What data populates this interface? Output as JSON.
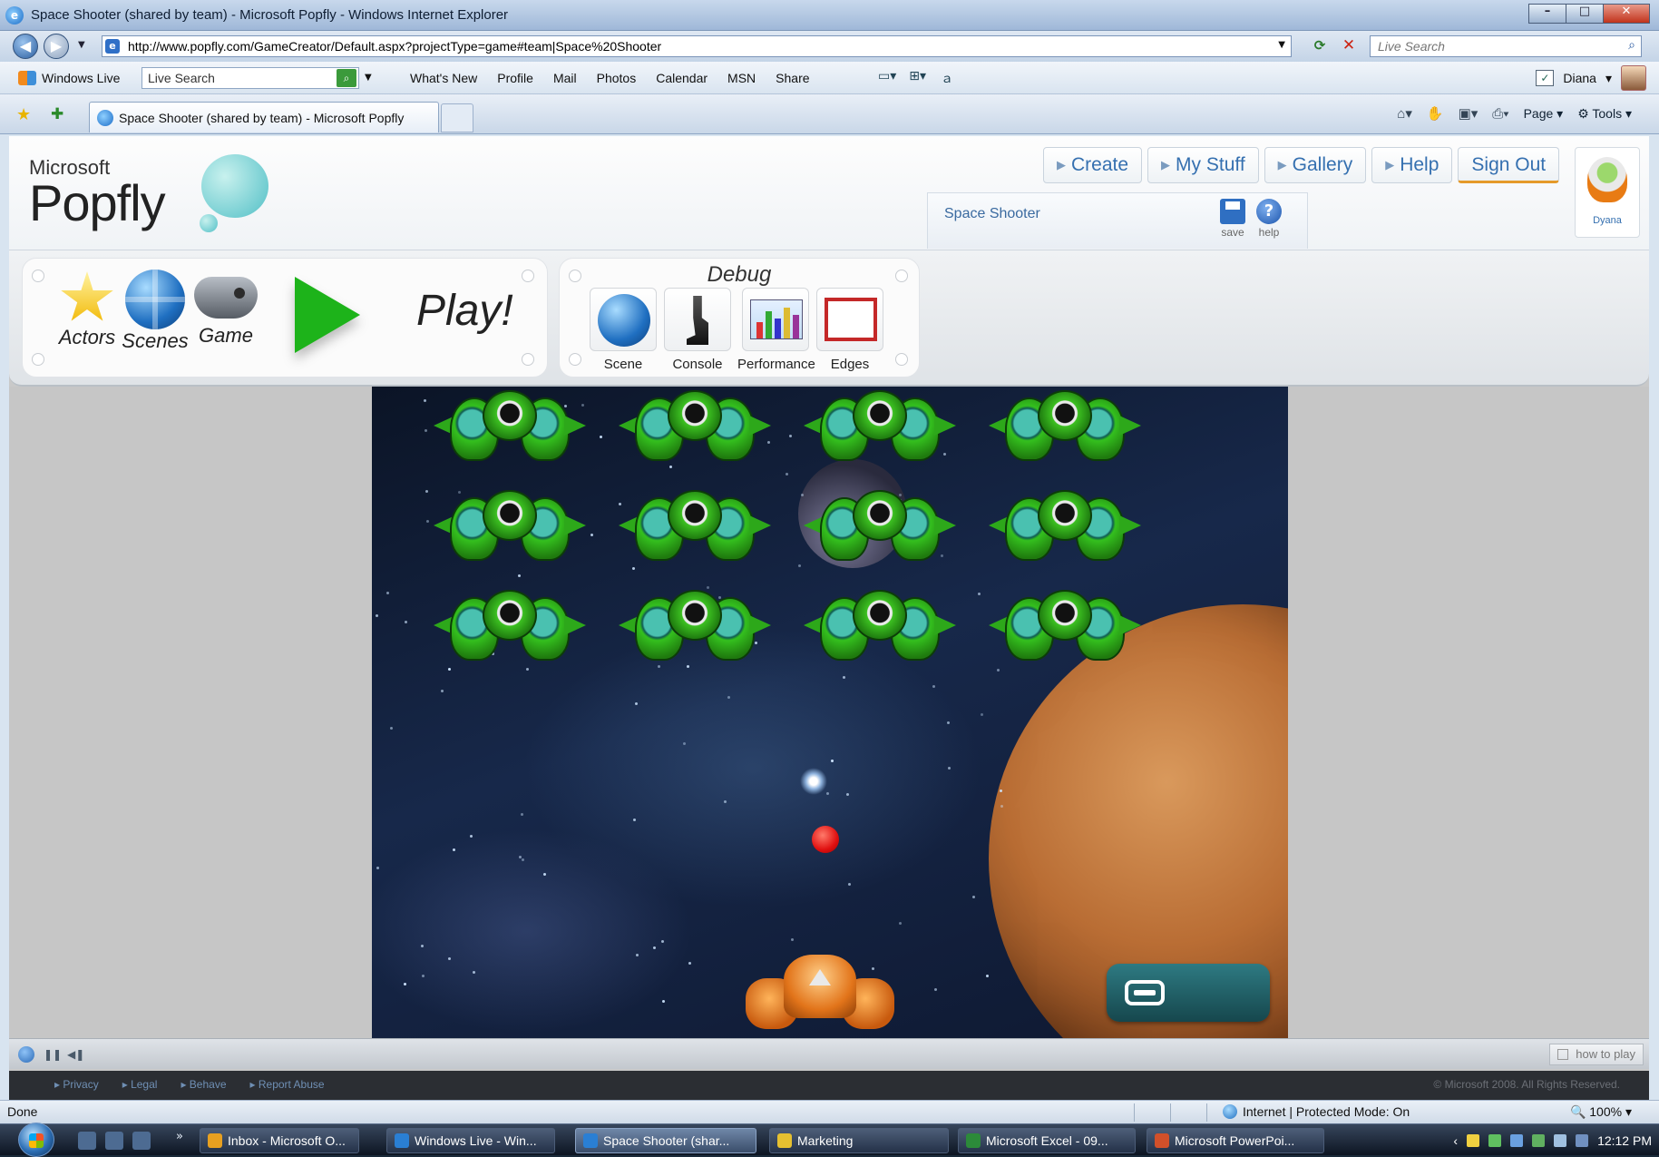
{
  "window": {
    "title": "Space Shooter (shared by team) - Microsoft Popfly - Windows Internet Explorer"
  },
  "address_bar": {
    "url": "http://www.popfly.com/GameCreator/Default.aspx?projectType=game#team|Space%20Shooter",
    "search_placeholder": "Live Search"
  },
  "wl_toolbar": {
    "brand": "Windows Live",
    "search_value": "Live Search",
    "links": [
      "What's New",
      "Profile",
      "Mail",
      "Photos",
      "Calendar",
      "MSN",
      "Share"
    ],
    "user": "Diana"
  },
  "tabs": {
    "active_label": "Space Shooter (shared by team) - Microsoft Popfly",
    "command_page": "Page",
    "command_tools": "Tools"
  },
  "popfly": {
    "logo_microsoft": "Microsoft",
    "logo_popfly": "Popfly",
    "nav": {
      "create": "Create",
      "my_stuff": "My Stuff",
      "gallery": "Gallery",
      "help": "Help",
      "sign_out": "Sign Out"
    },
    "avatar_name": "Dyana",
    "project_name": "Space Shooter",
    "save_label": "save",
    "help_label": "help",
    "build_tools": {
      "actors": "Actors",
      "scenes": "Scenes",
      "game": "Game",
      "play": "Play!"
    },
    "debug": {
      "title": "Debug",
      "scene": "Scene",
      "console": "Console",
      "performance": "Performance",
      "edges": "Edges"
    },
    "how_to_play": "how to play",
    "footer_links": [
      "Privacy",
      "Legal",
      "Behave",
      "Report Abuse"
    ],
    "copyright": "© Microsoft 2008. All Rights Reserved."
  },
  "status_bar": {
    "status": "Done",
    "zone": "Internet | Protected Mode: On",
    "zoom": "100%"
  },
  "taskbar": {
    "tasks": [
      "Inbox - Microsoft O...",
      "Windows Live - Win...",
      "Space Shooter (shar...",
      "Marketing",
      "Microsoft Excel - 09...",
      "Microsoft PowerPoi..."
    ],
    "clock": "12:12 PM"
  },
  "colors": {
    "accent_blue": "#3570b0",
    "play_green": "#1db31a",
    "enemy_green": "#34c01e",
    "bullet_red": "#e01010"
  },
  "icons": [
    "ie-icon",
    "back-icon",
    "forward-icon",
    "refresh-icon",
    "stop-icon",
    "search-icon",
    "favorites-star-icon",
    "home-icon",
    "print-icon",
    "save-disk-icon",
    "help-question-icon",
    "star-actors-icon",
    "globe-scenes-icon",
    "gamepad-icon",
    "play-arrow-icon",
    "microscope-icon",
    "performance-chart-icon",
    "edges-icon",
    "start-orb-icon"
  ]
}
